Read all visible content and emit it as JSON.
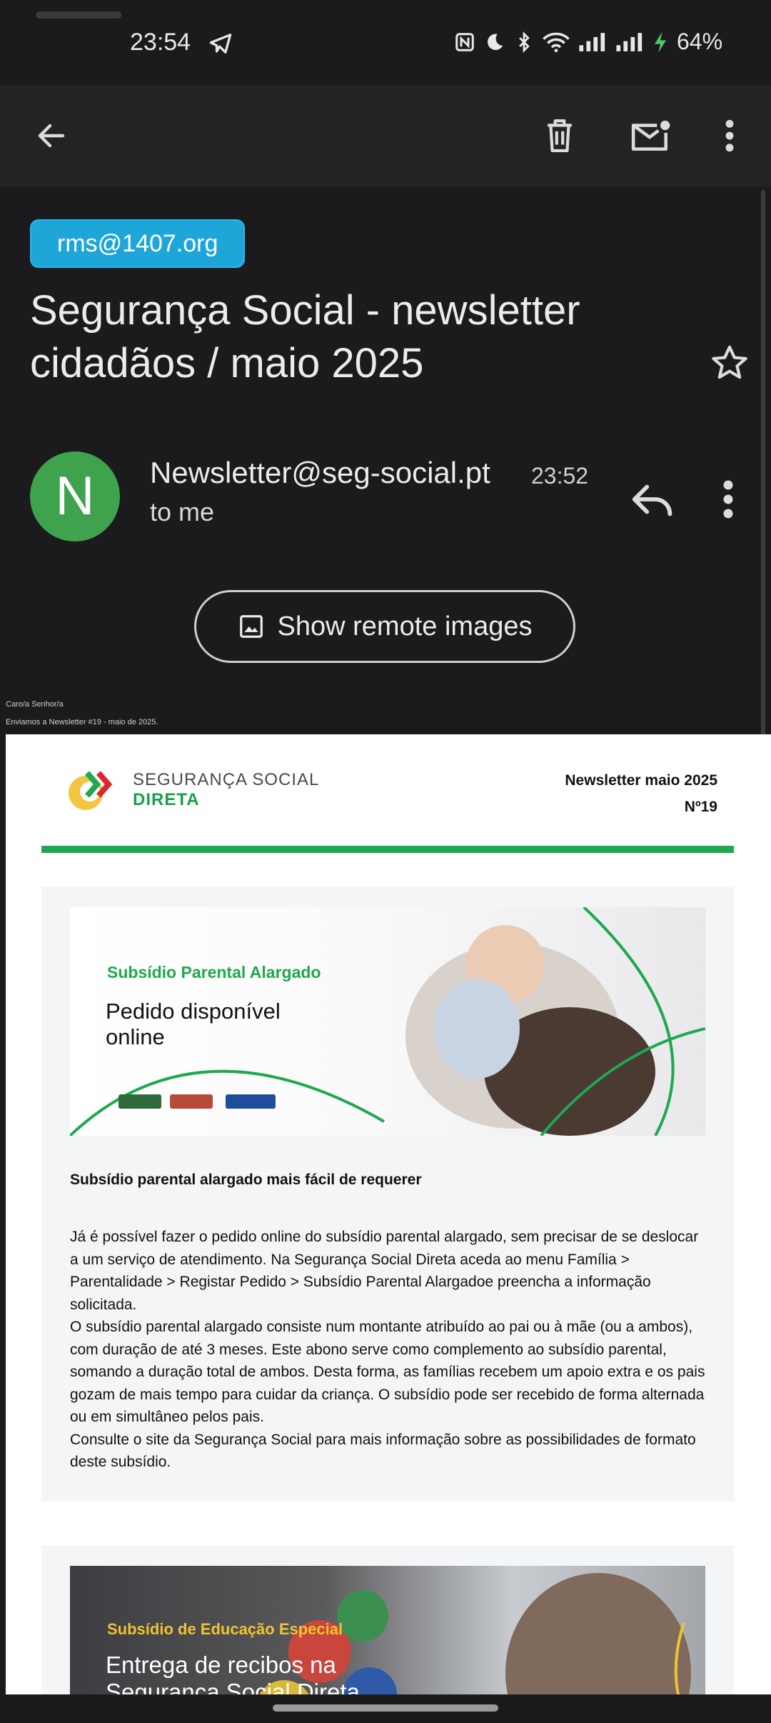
{
  "status_bar": {
    "time": "23:54",
    "battery": "64%",
    "icons": [
      "telegram-icon",
      "nfc-icon",
      "moon-icon",
      "bluetooth-icon",
      "wifi-icon",
      "signal-icon",
      "signal-icon",
      "charging-icon"
    ]
  },
  "toolbar": {
    "icons": [
      "back-arrow-icon",
      "delete-icon",
      "mark-unread-icon",
      "more-vert-icon"
    ]
  },
  "email": {
    "label": "rms@1407.org",
    "subject": "Segurança Social - newsletter cidadãos / maio 2025",
    "sender": "Newsletter@seg-social.pt",
    "time": "23:52",
    "recipient": "to me",
    "avatar_letter": "N",
    "avatar_color": "#3fa34d",
    "remote_images_button": "Show remote images",
    "greeting": "Caro/a Senhor/a",
    "intro": "Enviamos a Newsletter #19 - maio de 2025."
  },
  "newsletter": {
    "logo_line1": "SEGURANÇA SOCIAL",
    "logo_line2": "DIRETA",
    "title": "Newsletter maio 2025",
    "number": "Nº19",
    "accent": "#1ea84f",
    "article1": {
      "banner_kicker": "Subsídio Parental Alargado",
      "banner_title": "Pedido disponível online",
      "heading": "Subsídio parental alargado mais fácil de requerer",
      "paragraphs": [
        "Já é possível fazer o pedido online do subsídio parental alargado, sem precisar de se deslocar a um serviço de atendimento. Na Segurança Social Direta aceda ao menu Família > Parentalidade > Registar Pedido > Subsídio Parental Alargadoe preencha a informação solicitada.",
        "O subsídio parental alargado consiste num montante atribuído ao pai ou à mãe (ou a ambos), com duração de até 3 meses. Este abono serve como complemento ao subsídio parental, somando a duração total de ambos. Desta forma, as famílias recebem um apoio extra e os pais gozam de mais tempo para cuidar da criança. O subsídio pode ser recebido de forma alternada ou em simultâneo pelos pais.",
        "Consulte o site da Segurança Social para mais informação sobre as possibilidades de formato deste subsídio."
      ]
    },
    "article2": {
      "banner_kicker": "Subsídio de Educação Especial",
      "banner_title": "Entrega de recibos na Segurança Social Direta"
    }
  }
}
